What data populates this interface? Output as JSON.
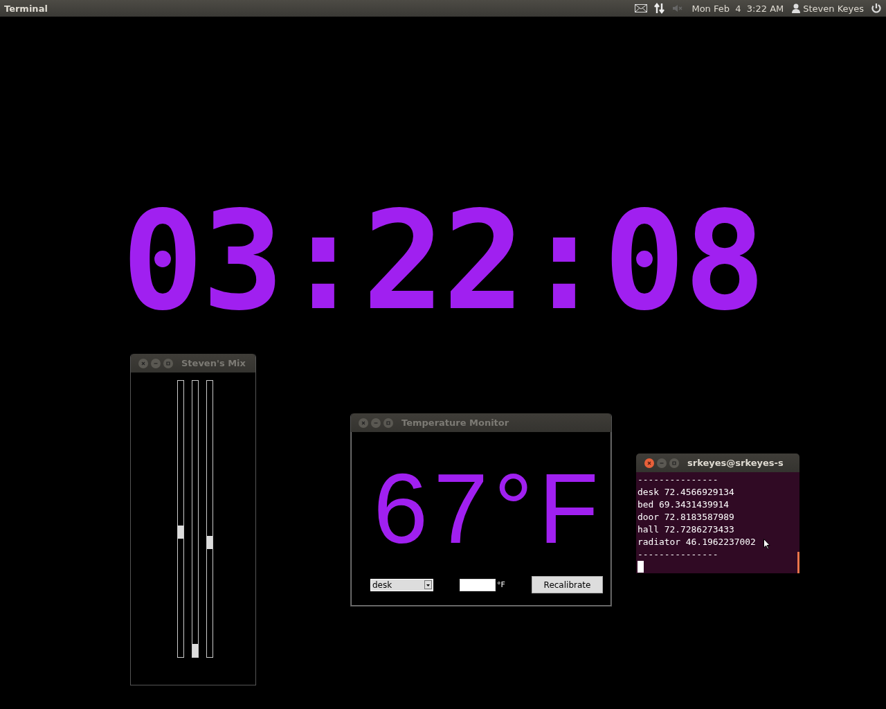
{
  "top_panel": {
    "app_title": "Terminal",
    "clock": "Mon Feb  4  3:22 AM",
    "user": "Steven Keyes"
  },
  "desktop_clock": {
    "time": "03:22:08"
  },
  "mixer_window": {
    "title": "Steven's Mix",
    "sliders": [
      {
        "level": 0.45
      },
      {
        "level": 0
      },
      {
        "level": 0.41
      }
    ]
  },
  "temperature_window": {
    "title": "Temperature Monitor",
    "reading": "67°F",
    "sensor_select": {
      "value": "desk"
    },
    "unit_label": "°F",
    "button": "Recalibrate"
  },
  "terminal_window": {
    "title": "srkeyes@srkeyes-s",
    "lines": [
      "---------------",
      "desk 72.4566929134",
      "bed 69.3431439914",
      "door 72.8183587989",
      "hall 72.7286273433",
      "radiator 46.1962237002",
      "---------------"
    ]
  }
}
